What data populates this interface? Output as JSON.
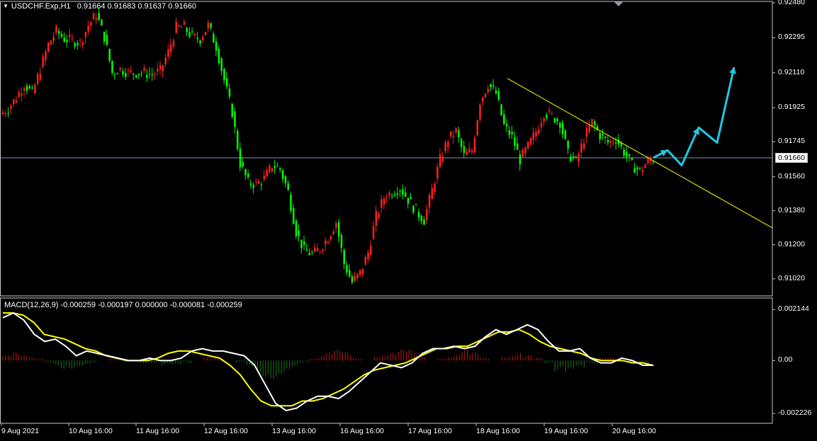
{
  "header": {
    "symbol": "USDCHF.Exp,H1",
    "ohlc": "0.91664 0.91683 0.91637 0.91660"
  },
  "macd_header": "MACD(12,26,9) -0.000259 -0.000197 0.000000 -0.000081 -0.000259",
  "chart_data": [
    {
      "type": "candlestick",
      "symbol": "USDCHF.Exp",
      "timeframe": "H1",
      "ylim": [
        0.9094,
        0.9248
      ],
      "y_ticks": [
        "0.92480",
        "0.92295",
        "0.92110",
        "0.91925",
        "0.91745",
        "0.91560",
        "0.91380",
        "0.91200",
        "0.91020"
      ],
      "current_price": "0.91660",
      "x_ticks": [
        "9 Aug 2021",
        "10 Aug 16:00",
        "11 Aug 16:00",
        "12 Aug 16:00",
        "13 Aug 16:00",
        "16 Aug 16:00",
        "17 Aug 16:00",
        "18 Aug 16:00",
        "19 Aug 16:00",
        "20 Aug 16:00"
      ],
      "close_path": [
        0.9192,
        0.9198,
        0.9205,
        0.92,
        0.9213,
        0.9226,
        0.9233,
        0.9229,
        0.9228,
        0.9227,
        0.9236,
        0.9242,
        0.923,
        0.9211,
        0.9213,
        0.9211,
        0.9211,
        0.9211,
        0.921,
        0.9212,
        0.9222,
        0.9235,
        0.9235,
        0.923,
        0.9229,
        0.9236,
        0.9225,
        0.9207,
        0.919,
        0.9163,
        0.9153,
        0.9152,
        0.9155,
        0.9162,
        0.916,
        0.9148,
        0.9127,
        0.9117,
        0.9115,
        0.9118,
        0.9124,
        0.9132,
        0.911,
        0.91,
        0.9105,
        0.9116,
        0.9135,
        0.9145,
        0.9148,
        0.915,
        0.9144,
        0.9138,
        0.9133,
        0.9149,
        0.9165,
        0.9176,
        0.918,
        0.9167,
        0.917,
        0.9196,
        0.9205,
        0.92,
        0.9183,
        0.9177,
        0.9165,
        0.9172,
        0.918,
        0.919,
        0.9188,
        0.9185,
        0.9168,
        0.9164,
        0.9176,
        0.9185,
        0.9178,
        0.9174,
        0.9176,
        0.9169,
        0.9162,
        0.9159,
        0.9164,
        0.9166
      ],
      "trendline": {
        "from": [
          0.365,
          0.9208
        ],
        "to": [
          0.545,
          0.9157
        ],
        "color": "#ffff00"
      },
      "projection_arrows": [
        0.9166,
        0.917,
        0.9162,
        0.9182,
        0.9174,
        0.9214
      ],
      "candle_colors": {
        "up": "#ff2020",
        "down": "#00ff00"
      },
      "horizontal_line": "#7f95aa"
    },
    {
      "type": "line",
      "indicator": "MACD(12,26,9)",
      "ylim": [
        -0.0024,
        0.0023
      ],
      "y_ticks": [
        "0.002144",
        "0.00",
        "-0.002226"
      ],
      "series": [
        {
          "color": "#ffffff",
          "values": [
            0.0018,
            0.002,
            0.0017,
            0.0011,
            0.0008,
            0.0009,
            0.0006,
            0.0002,
            0.0004,
            0.0003,
            0.0002,
            0.0001,
            0.0,
            0.0,
            0.0001,
            0.0,
            0.0,
            0.0001,
            0.0004,
            0.0005,
            0.0004,
            0.0004,
            0.0003,
            0.0002,
            -0.0002,
            -0.001,
            -0.0018,
            -0.0021,
            -0.002,
            -0.0017,
            -0.0015,
            -0.0015,
            -0.0016,
            -0.0013,
            -0.0009,
            -0.0005,
            -0.0001,
            -0.0002,
            -0.0003,
            -0.0001,
            0.0003,
            0.0005,
            0.0005,
            0.0006,
            0.0005,
            0.0006,
            0.001,
            0.0013,
            0.0011,
            0.0013,
            0.0015,
            0.0013,
            0.0008,
            0.0004,
            0.0004,
            0.0005,
            0.0001,
            -0.0001,
            -0.0001,
            0.0001,
            0.0,
            -0.0002,
            -0.0002
          ]
        },
        {
          "color": "#ffff00",
          "values": [
            0.002,
            0.002,
            0.0019,
            0.0016,
            0.0011,
            0.001,
            0.0009,
            0.0007,
            0.0005,
            0.0004,
            0.0002,
            0.0001,
            0.0,
            0.0,
            0.0,
            0.0001,
            0.0003,
            0.0004,
            0.0004,
            0.0003,
            0.0002,
            0.0001,
            -0.0002,
            -0.0006,
            -0.0012,
            -0.0017,
            -0.0019,
            -0.0019,
            -0.0019,
            -0.0017,
            -0.0017,
            -0.0016,
            -0.0014,
            -0.0012,
            -0.0009,
            -0.0006,
            -0.0004,
            -0.0003,
            -0.0002,
            -0.0001,
            0.0001,
            0.0003,
            0.0005,
            0.0005,
            0.0006,
            0.0006,
            0.0008,
            0.001,
            0.0012,
            0.0012,
            0.0013,
            0.0011,
            0.0008,
            0.0006,
            0.0005,
            0.0004,
            0.0003,
            0.0001,
            0.0,
            0.0,
            0.0,
            -0.0001,
            -0.0001,
            -0.0002
          ]
        },
        {
          "color": "#ff2020",
          "values": [
            0.0002,
            0.0003,
            0.0002,
            0.0001,
            -0.0001,
            -0.0003,
            -0.0003,
            -0.0002,
            -0.0001,
            0.0,
            0.0001,
            0.0,
            0.0,
            -0.0001,
            -0.0001,
            -0.0002,
            -0.0002,
            -0.0001,
            0.0,
            0.0001,
            0.0001,
            0.0,
            -0.0001,
            -0.0003,
            -0.0006,
            -0.0007,
            -0.0005,
            -0.0003,
            -0.0001,
            0.0001,
            0.0003,
            0.0004,
            0.0003,
            0.0001,
            0.0,
            0.0002,
            0.0003,
            0.0004,
            0.0004,
            0.0002,
            0.0,
            0.0001,
            0.0002,
            0.0004,
            0.0003,
            0.0001,
            0.0,
            0.0002,
            0.0003,
            0.0002,
            0.0001,
            -0.0001,
            -0.0004,
            -0.0005,
            -0.0003,
            -0.0001,
            0.0001,
            0.0001,
            0.0,
            -0.0001,
            -0.0001,
            0.0
          ]
        }
      ]
    }
  ]
}
